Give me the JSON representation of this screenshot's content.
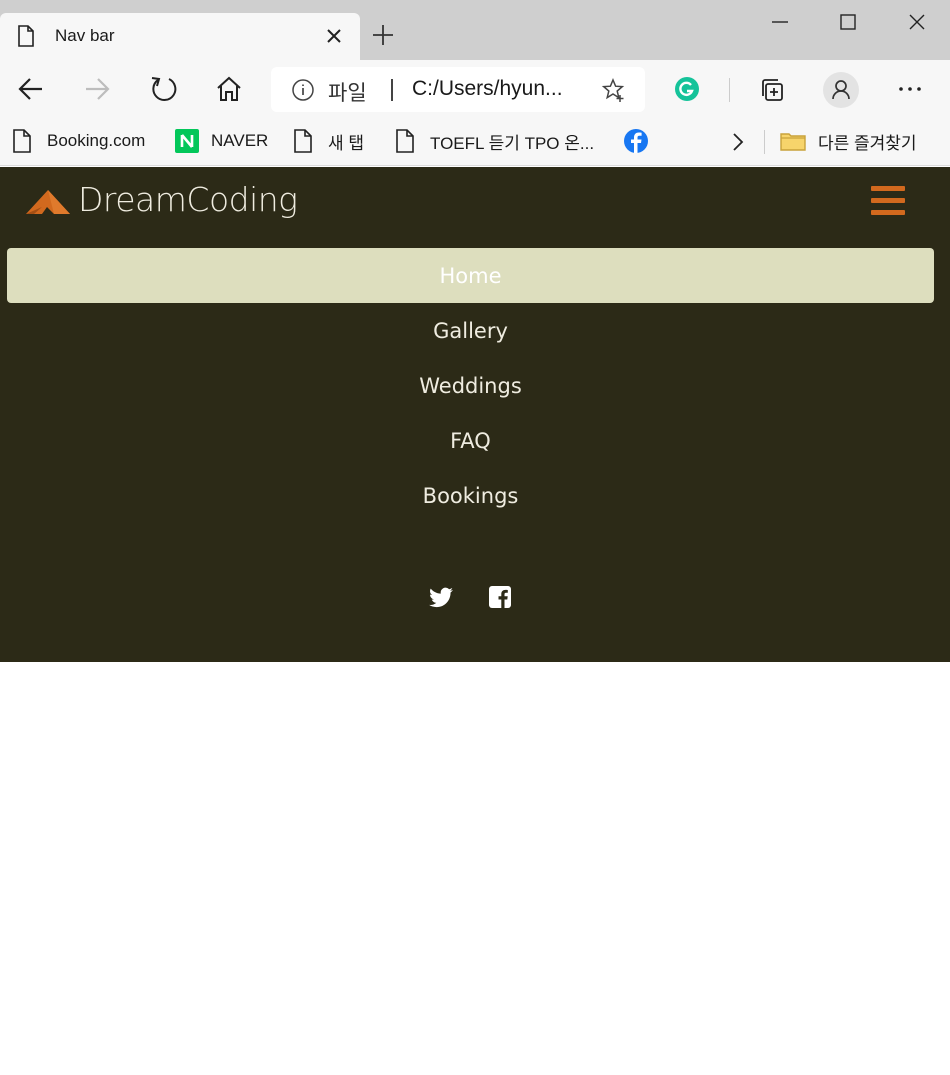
{
  "browser": {
    "tab_title": "Nav bar",
    "address_scheme": "파일",
    "address_url": "C:/Users/hyun...",
    "bookmarks": [
      {
        "label": "Booking.com",
        "icon": "page-icon"
      },
      {
        "label": "NAVER",
        "icon": "naver-icon"
      },
      {
        "label": "새 탭",
        "icon": "page-icon"
      },
      {
        "label": "TOEFL 듣기 TPO 온...",
        "icon": "page-icon"
      },
      {
        "label": "",
        "icon": "facebook-icon"
      }
    ],
    "other_bookmarks": "다른 즐겨찾기"
  },
  "site": {
    "brand": "DreamCoding",
    "brand_color": "#d2691e",
    "nav_bg": "#2c2a17",
    "menu": [
      {
        "label": "Home",
        "active": true
      },
      {
        "label": "Gallery",
        "active": false
      },
      {
        "label": "Weddings",
        "active": false
      },
      {
        "label": "FAQ",
        "active": false
      },
      {
        "label": "Bookings",
        "active": false
      }
    ],
    "social": [
      "twitter-icon",
      "facebook-square-icon"
    ]
  }
}
